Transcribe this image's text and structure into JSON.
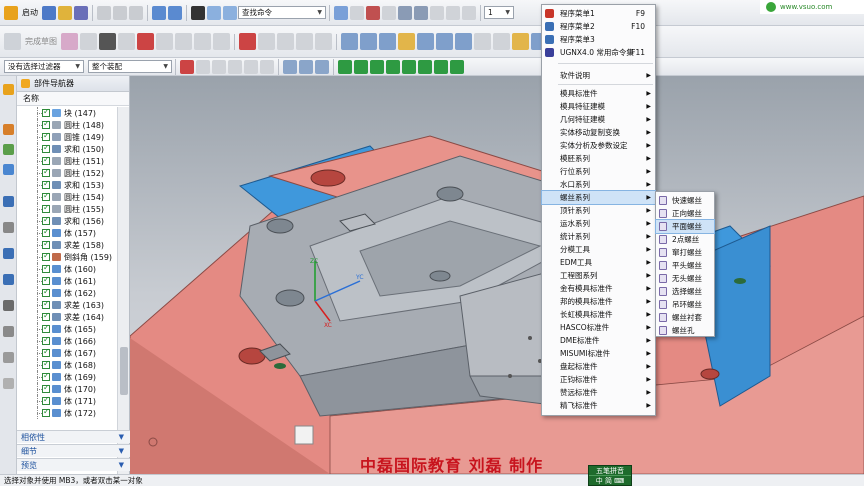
{
  "toolbar": {
    "start_label": "启动",
    "command_search": "查找命令",
    "view_value": "1",
    "filter_value": "没有选择过滤器",
    "assembly_value": "整个装配",
    "disabled_label": "完成草图"
  },
  "navigator": {
    "title": "部件导航器",
    "column_header": "名称",
    "items": [
      "块 (147)",
      "圆柱 (148)",
      "圆锥 (149)",
      "求和 (150)",
      "圆柱 (151)",
      "圆柱 (152)",
      "求和 (153)",
      "圆柱 (154)",
      "圆柱 (155)",
      "求和 (156)",
      "体 (157)",
      "求差 (158)",
      "倒斜角 (159)",
      "体 (160)",
      "体 (161)",
      "体 (162)",
      "求差 (163)",
      "求差 (164)",
      "体 (165)",
      "体 (166)",
      "体 (167)",
      "体 (168)",
      "体 (169)",
      "体 (170)",
      "体 (171)",
      "体 (172)"
    ],
    "panels": [
      "相依性",
      "细节",
      "预览"
    ]
  },
  "menu": {
    "top_items": [
      {
        "label": "程序菜单1",
        "shortcut": "F9"
      },
      {
        "label": "程序菜单2",
        "shortcut": "F10"
      },
      {
        "label": "程序菜单3",
        "shortcut": ""
      },
      {
        "label": "UGNX4.0 常用命令集",
        "shortcut": "F11"
      }
    ],
    "items": [
      "软件说明",
      "模具标准件",
      "模具特征建模",
      "几何特征建模",
      "实体移动复制变换",
      "实体分析及参数设定",
      "模胚系列",
      "行位系列",
      "水口系列",
      "螺丝系列",
      "顶针系列",
      "运水系列",
      "统计系列",
      "分模工具",
      "EDM工具",
      "工程图系列",
      "金有模具标准件",
      "邦的模具标准件",
      "长虹模具标准件",
      "HASCO标准件",
      "DME标准件",
      "MISUMI标准件",
      "盘起标准件",
      "正钧标准件",
      "赞远标准件",
      "精飞标准件"
    ],
    "highlighted": "螺丝系列",
    "submenu": [
      "快速螺丝",
      "正向螺丝",
      "平面螺丝",
      "2点螺丝",
      "窜打螺丝",
      "平头螺丝",
      "无头螺丝",
      "选择螺丝",
      "吊环螺丝",
      "螺丝衬套",
      "螺丝孔"
    ],
    "submenu_highlighted": "平面螺丝"
  },
  "viewport": {
    "axis_z": "ZC",
    "axis_x": "XC",
    "axis_y": "YC"
  },
  "overlay": {
    "caption": "中磊国际教育  刘磊  制作",
    "ime_title": "五笔拼音",
    "ime_sub": "中  简  ⌨",
    "logo_text": "www.vsuo.com"
  },
  "status": "选择对象并使用 MB3，或者双击某一对象",
  "colors": {
    "plate_red": "#e48a83",
    "plate_blue": "#3f98dc",
    "steel_grey": "#a7acb3",
    "menu_highlight": "#cfe3f7",
    "caption_red": "#c8141e"
  }
}
